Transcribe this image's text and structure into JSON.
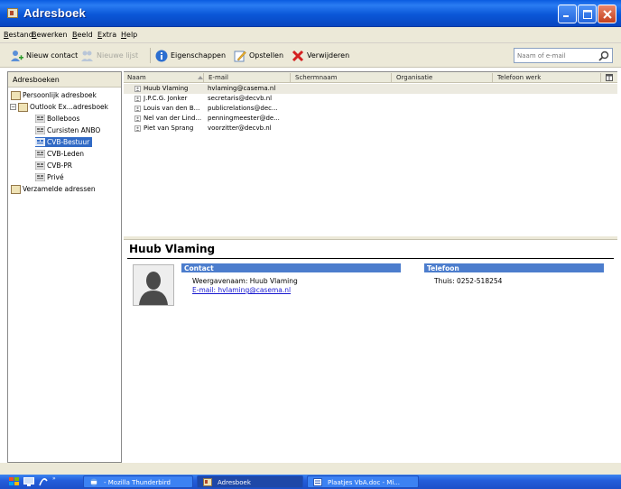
{
  "window": {
    "title": "Adresboek"
  },
  "menu": [
    "Bestand",
    "Bewerken",
    "Beeld",
    "Extra",
    "Help"
  ],
  "toolbar": {
    "new_contact": "Nieuw contact",
    "new_list": "Nieuwe lijst",
    "properties": "Eigenschappen",
    "compose": "Opstellen",
    "delete": "Verwijderen"
  },
  "search": {
    "placeholder": "Naam of e-mail"
  },
  "sidebar": {
    "header": "Adresboeken",
    "items": [
      {
        "label": "Persoonlijk adresboek"
      },
      {
        "label": "Outlook Ex...adresboek"
      },
      {
        "label": "Bolleboos"
      },
      {
        "label": "Cursisten ANBO"
      },
      {
        "label": "CVB-Bestuur"
      },
      {
        "label": "CVB-Leden"
      },
      {
        "label": "CVB-PR"
      },
      {
        "label": "Privé"
      },
      {
        "label": "Verzamelde adressen"
      }
    ]
  },
  "list": {
    "columns": [
      "Naam",
      "E-mail",
      "Schermnaam",
      "Organisatie",
      "Telefoon werk"
    ],
    "rows": [
      {
        "name": "Huub Vlaming",
        "email": "hvlaming@casema.nl"
      },
      {
        "name": "J.P.C.G. Jonker",
        "email": "secretaris@decvb.nl"
      },
      {
        "name": "Louis van den B...",
        "email": "publicrelations@dec..."
      },
      {
        "name": "Nel van der Lind...",
        "email": "penningmeester@de..."
      },
      {
        "name": "Piet van Sprang",
        "email": "voorzitter@decvb.nl"
      }
    ]
  },
  "detail": {
    "name": "Huub Vlaming",
    "contact_header": "Contact",
    "display_name": "Weergavenaam: Huub Vlaming",
    "email_line": "E-mail: hvlaming@casema.nl",
    "phone_header": "Telefoon",
    "phone": "Thuis: 0252-518254"
  },
  "taskbar": {
    "tasks": [
      "- Mozilla Thunderbird",
      "Adresboek",
      "Plaatjes VbA.doc - Mi..."
    ]
  },
  "colors": {
    "selection": "#316ac5",
    "section_bar": "#4c7dcd",
    "titlebar": "#0a5be0"
  }
}
